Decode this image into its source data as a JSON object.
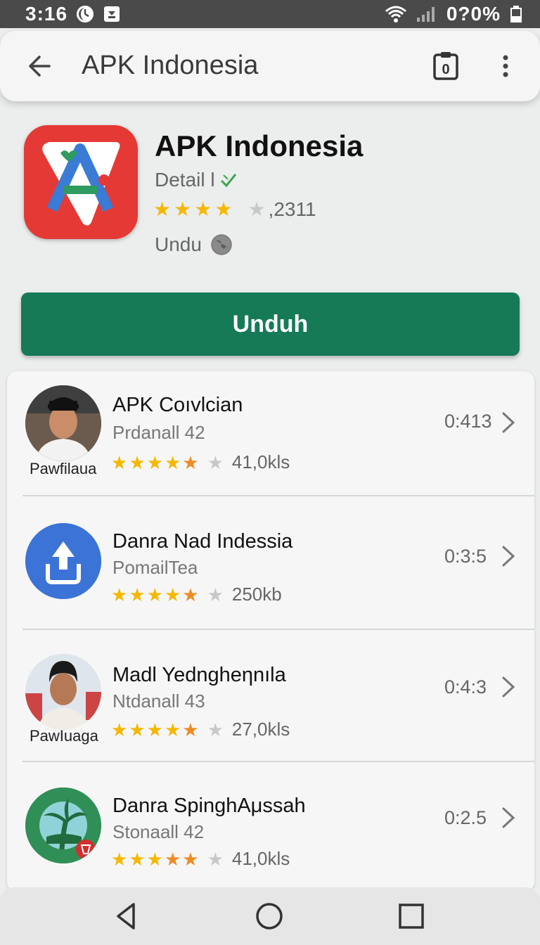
{
  "status_bar": {
    "time": "3:16",
    "battery": "0?0%",
    "icons": [
      "moon-icon",
      "notification-icon",
      "wifi-icon",
      "signal-icon",
      "battery-icon"
    ]
  },
  "app_bar": {
    "title": "APK Indonesia",
    "icons": [
      "back-arrow-icon",
      "clipboard-icon",
      "more-vert-icon"
    ],
    "clipboard_count": "0"
  },
  "app_header": {
    "name": "APK Indonesia",
    "detail": "Detail l",
    "rating_stars": 4,
    "rating_count": ",2311",
    "download_label": "Undu"
  },
  "download_button": {
    "label": "Unduh",
    "color": "#167a56"
  },
  "list": {
    "items": [
      {
        "title": "APK Coıvlcian",
        "subtitle": "Prdanall 42",
        "caption": "Pawfilaua",
        "rating": 4.5,
        "size": "41,0kls",
        "time": "0:413",
        "avatar": "person-photo-1"
      },
      {
        "title": "Danra Nad Indessia",
        "subtitle": "PomailTea",
        "caption": "",
        "rating": 4.5,
        "size": "250kb",
        "time": "0:3:5",
        "avatar": "upload-icon"
      },
      {
        "title": "Madl Yedngheηnıla",
        "subtitle": "Ntdanall 43",
        "caption": "PawIuaga",
        "rating": 4.5,
        "size": "27,0kls",
        "time": "0:4:3",
        "avatar": "person-photo-2"
      },
      {
        "title": "Danra SpinghAμssah",
        "subtitle": "Stonaall 42",
        "caption": "",
        "rating": 4.5,
        "size": "41,0kls",
        "time": "0:2.5",
        "avatar": "palm-tree-icon"
      }
    ]
  },
  "nav_bar": {
    "icons": [
      "nav-back-icon",
      "nav-home-icon",
      "nav-recents-icon"
    ]
  }
}
